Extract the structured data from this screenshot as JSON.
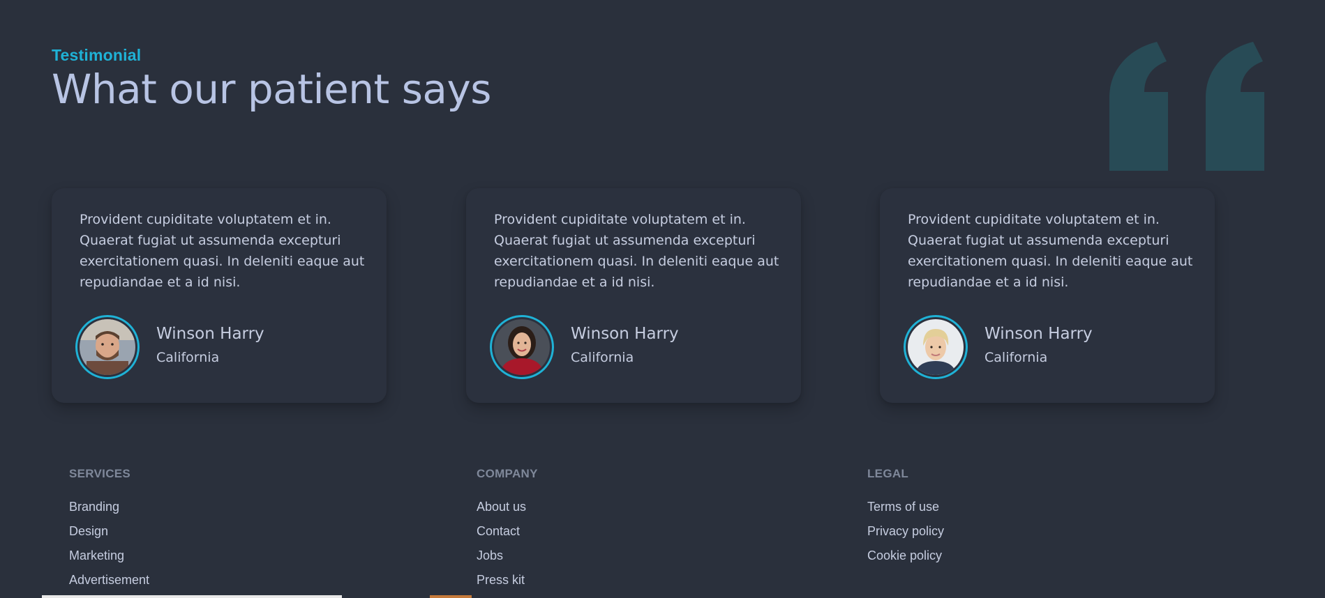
{
  "section": {
    "eyebrow": "Testimonial",
    "heading": "What our patient says"
  },
  "colors": {
    "background": "#2a303c",
    "accent": "#1fb2d6",
    "quote_mark": "#284b56",
    "text": "#c6cde0",
    "muted": "#7f889a"
  },
  "testimonials": [
    {
      "text": "Provident cupiditate voluptatem et in. Quaerat fugiat ut assumenda excepturi exercitationem quasi. In deleniti eaque aut repudiandae et a id nisi.",
      "name": "Winson Harry",
      "location": "California",
      "avatar": "man-avatar"
    },
    {
      "text": "Provident cupiditate voluptatem et in. Quaerat fugiat ut assumenda excepturi exercitationem quasi. In deleniti eaque aut repudiandae et a id nisi.",
      "name": "Winson Harry",
      "location": "California",
      "avatar": "woman-red-top-avatar"
    },
    {
      "text": "Provident cupiditate voluptatem et in. Quaerat fugiat ut assumenda excepturi exercitationem quasi. In deleniti eaque aut repudiandae et a id nisi.",
      "name": "Winson Harry",
      "location": "California",
      "avatar": "woman-blonde-avatar"
    }
  ],
  "footer": {
    "services": {
      "title": "SERVICES",
      "links": [
        "Branding",
        "Design",
        "Marketing",
        "Advertisement"
      ]
    },
    "company": {
      "title": "COMPANY",
      "links": [
        "About us",
        "Contact",
        "Jobs",
        "Press kit"
      ]
    },
    "legal": {
      "title": "LEGAL",
      "links": [
        "Terms of use",
        "Privacy policy",
        "Cookie policy"
      ]
    }
  }
}
